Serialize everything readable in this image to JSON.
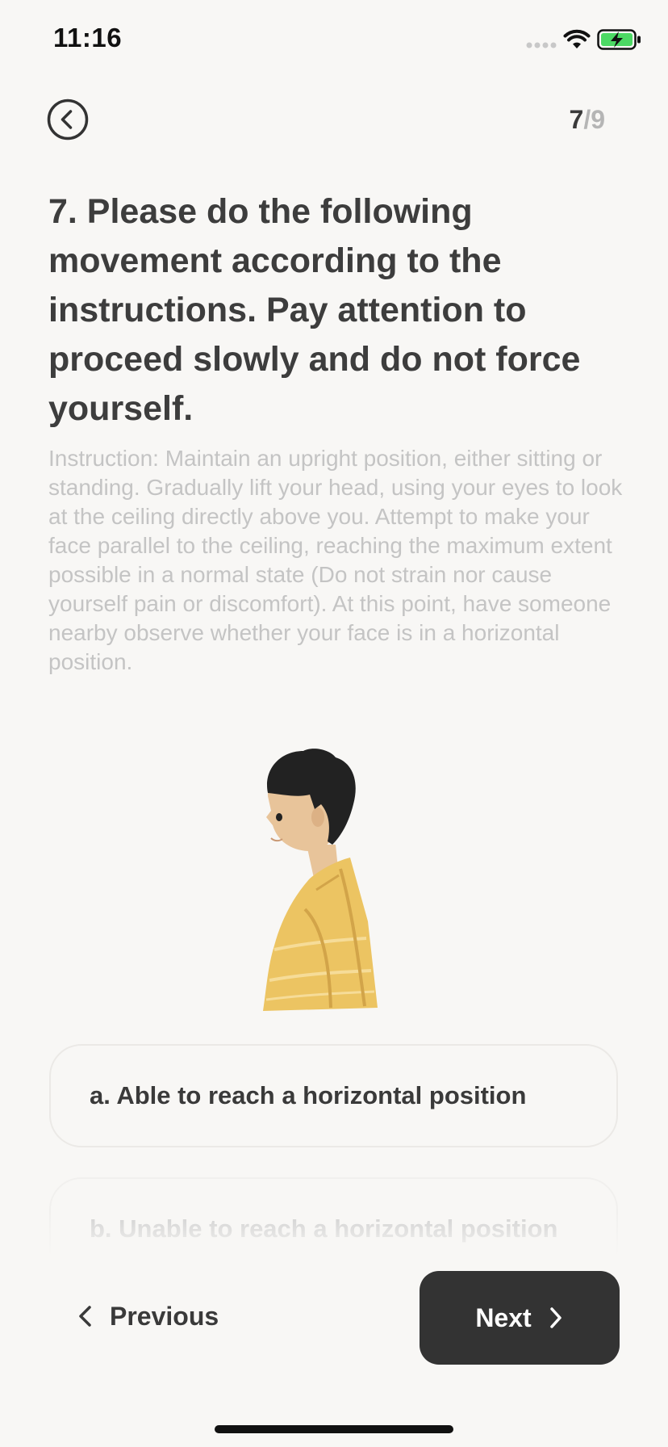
{
  "status_bar": {
    "time": "11:16"
  },
  "header": {
    "back_icon": "chevron-left-circle-icon",
    "page_current": "7",
    "page_separator": "/",
    "page_total": "9"
  },
  "question": {
    "title": "7. Please do the following movement according to the instructions. Pay attention to proceed slowly and do not force yourself.",
    "instruction": "Instruction: Maintain an upright position, either sitting or standing. Gradually lift your head, using your eyes to look at the ceiling directly above you. Attempt to make your face parallel to the ceiling, reaching the maximum extent possible in a normal state (Do not strain nor cause yourself pain or discomfort). At this point, have someone nearby observe whether your face is in a horizontal position."
  },
  "options": [
    {
      "label": "a. Able to reach a horizontal position"
    },
    {
      "label": "b. Unable to reach a horizontal position"
    }
  ],
  "footer": {
    "previous_label": "Previous",
    "next_label": "Next"
  },
  "colors": {
    "background": "#f8f7f5",
    "primary_text": "#3a3a3a",
    "muted_text": "#c4c4c4",
    "next_button": "#333333",
    "battery_green": "#4cd964",
    "shirt_yellow": "#ecc462",
    "hair": "#222222",
    "skin": "#e8c49a"
  }
}
